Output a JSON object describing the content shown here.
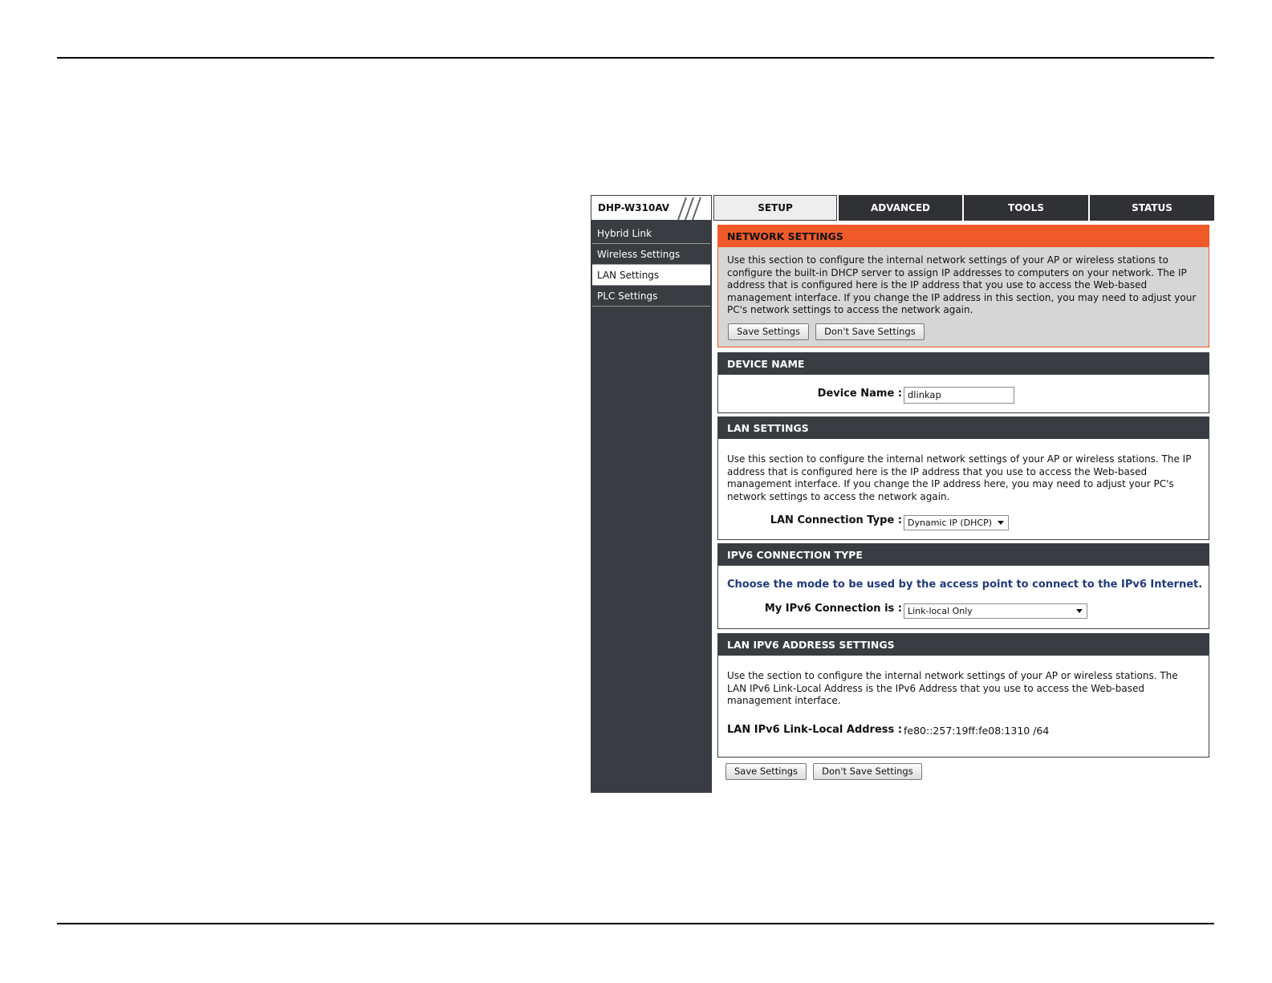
{
  "logo": {
    "model": "DHP-W310AV"
  },
  "nav": {
    "tabs": [
      {
        "label": "SETUP",
        "active": true
      },
      {
        "label": "ADVANCED",
        "active": false
      },
      {
        "label": "TOOLS",
        "active": false
      },
      {
        "label": "STATUS",
        "active": false
      }
    ]
  },
  "sidebar": {
    "items": [
      {
        "label": "Hybrid Link"
      },
      {
        "label": "Wireless Settings"
      },
      {
        "label": "LAN Settings",
        "active": true
      },
      {
        "label": "PLC Settings"
      }
    ]
  },
  "network": {
    "title": "NETWORK SETTINGS",
    "description": "Use this section to configure the internal network settings of your AP or wireless stations to configure the built-in DHCP server to assign IP addresses to computers on your network. The IP address that is configured here is the IP address that you use to access the Web-based management interface. If you change the IP address in this section, you may need to adjust your PC's network settings to access the network again.",
    "save_label": "Save Settings",
    "dont_save_label": "Don't Save Settings"
  },
  "device": {
    "title": "DEVICE NAME",
    "label": "Device Name :",
    "value": "dlinkap"
  },
  "lan": {
    "title": "LAN SETTINGS",
    "description": "Use this section to configure the internal network settings of your AP or wireless stations. The IP address that is configured here is the IP address that you use to access the Web-based management interface. If you change the IP address here, you may need to adjust your PC's network settings to access the network again.",
    "conn_label": "LAN Connection Type :",
    "conn_value": "Dynamic IP (DHCP)"
  },
  "ipv6": {
    "title": "IPV6 CONNECTION TYPE",
    "prompt": "Choose the mode to be used by the access point to connect to the IPv6 Internet.",
    "conn_label": "My IPv6 Connection is :",
    "conn_value": "Link-local Only"
  },
  "lanv6": {
    "title": "LAN IPV6 ADDRESS SETTINGS",
    "description": "Use the section to configure the internal network settings of your AP or wireless stations. The LAN IPv6 Link-Local Address is the IPv6 Address that you use to access the Web-based management interface.",
    "addr_label": "LAN IPv6 Link-Local Address :",
    "addr_value": "fe80::257:19ff:fe08:1310 /64"
  },
  "bottom": {
    "save_label": "Save Settings",
    "dont_save_label": "Don't Save Settings"
  },
  "colors": {
    "accent": "#f05a28",
    "dark": "#393c40",
    "link_blue": "#223a7a"
  }
}
